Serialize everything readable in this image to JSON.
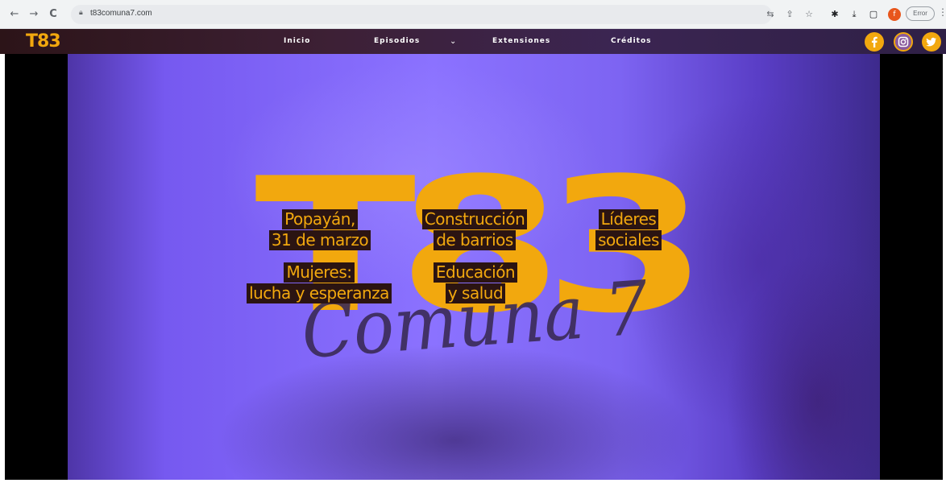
{
  "browser": {
    "back_glyph": "←",
    "forward_glyph": "→",
    "reload_glyph": "C",
    "url": "t83comuna7.com",
    "profile_initial": "f",
    "update_label": "Error",
    "menu_glyph": "⋮"
  },
  "site": {
    "logo": "T83",
    "nav": [
      {
        "label": "Inicio"
      },
      {
        "label": "Episodios"
      },
      {
        "label": "Extensiones"
      },
      {
        "label": "Créditos"
      }
    ],
    "social": [
      "facebook-icon",
      "instagram-icon",
      "twitter-icon"
    ]
  },
  "hero": {
    "mark_text": "T83",
    "script_text": "Comuna 7",
    "topics": [
      {
        "lines": [
          "Popayán,",
          "31 de marzo"
        ]
      },
      {
        "lines": [
          "Construcción",
          "de barrios"
        ]
      },
      {
        "lines": [
          "Líderes",
          "sociales"
        ]
      },
      {
        "lines": [
          "Mujeres:",
          "lucha y esperanza"
        ]
      },
      {
        "lines": [
          "Educación",
          "y salud"
        ]
      }
    ]
  },
  "colors": {
    "brand_yellow": "#f2a80e",
    "label_bg": "#2b1412",
    "hero_purple": "#8b72ff",
    "script_purple": "#3a2a55"
  }
}
